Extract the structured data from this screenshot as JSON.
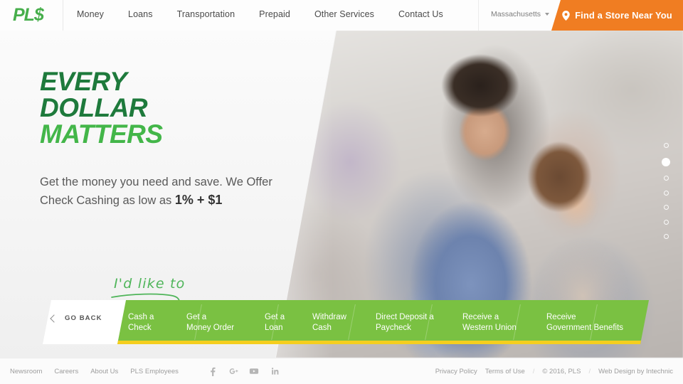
{
  "header": {
    "logo": "PL$",
    "nav": [
      {
        "label": "Money"
      },
      {
        "label": "Loans"
      },
      {
        "label": "Transportation"
      },
      {
        "label": "Prepaid"
      },
      {
        "label": "Other Services"
      },
      {
        "label": "Contact Us"
      }
    ],
    "state_selector": {
      "value": "Massachusetts",
      "icon": "chevron-down-icon"
    },
    "cta": {
      "label": "Find a Store Near You",
      "icon": "map-pin-icon",
      "color": "#f07d22"
    }
  },
  "hero": {
    "headline_line1": "EVERY",
    "headline_line2": "DOLLAR",
    "headline_line3": "MATTERS",
    "headline_color_dark": "#1e7a3c",
    "headline_color_light": "#43b649",
    "subcopy_prefix": "Get the money you need and save. We Offer Check Cashing as low as ",
    "subcopy_highlight": "1% + $1",
    "script_text": "I'd like to",
    "script_color": "#4fb55a",
    "slides": {
      "total": 7,
      "active_index": 1
    }
  },
  "service_bar": {
    "go_back_label": "GO BACK",
    "go_back_icon": "chevron-left-icon",
    "accent_green": "#7ac142",
    "accent_yellow": "#f5ce1e",
    "items": [
      {
        "line1": "Cash a",
        "line2": "Check"
      },
      {
        "line1": "Get a",
        "line2": "Money Order"
      },
      {
        "line1": "Get a",
        "line2": "Loan"
      },
      {
        "line1": "Withdraw",
        "line2": "Cash"
      },
      {
        "line1": "Direct Deposit a",
        "line2": "Paycheck"
      },
      {
        "line1": "Receive a",
        "line2": "Western Union"
      },
      {
        "line1": "Receive",
        "line2": "Government Benefits"
      }
    ]
  },
  "footer": {
    "links": [
      {
        "label": "Newsroom"
      },
      {
        "label": "Careers"
      },
      {
        "label": "About Us"
      },
      {
        "label": "PLS Employees"
      }
    ],
    "socials": [
      {
        "name": "facebook-icon"
      },
      {
        "name": "google-plus-icon"
      },
      {
        "name": "youtube-icon"
      },
      {
        "name": "linkedin-icon"
      }
    ],
    "right_links": [
      {
        "label": "Privacy Policy"
      },
      {
        "label": "Terms of Use"
      }
    ],
    "copyright": "© 2016, PLS",
    "credit": "Web Design by Intechnic",
    "separator": "/"
  }
}
